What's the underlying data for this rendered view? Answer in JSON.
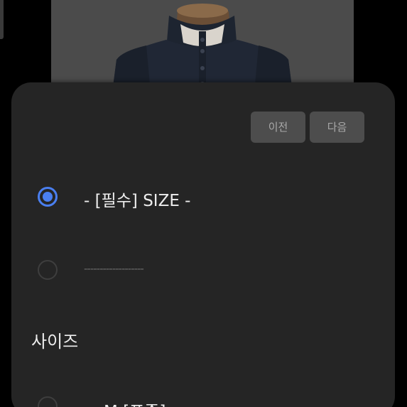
{
  "navigation": {
    "prev_label": "이전",
    "next_label": "다음"
  },
  "options_required": {
    "items": [
      {
        "label": "- [필수] SIZE -",
        "selected": true
      },
      {
        "label": "-------------------",
        "selected": false
      }
    ]
  },
  "size_section": {
    "title": "사이즈",
    "items": [
      {
        "label": "M [표준]",
        "selected": false
      }
    ]
  },
  "colors": {
    "accent": "#4a7ff0",
    "sheet_background": "#252525",
    "button_background": "#4d4d4d",
    "text_primary": "#ededed",
    "text_muted": "#a9a9a9"
  },
  "icons": {
    "radio_selected": "radio-selected-icon",
    "radio_unselected": "radio-unselected-icon"
  }
}
